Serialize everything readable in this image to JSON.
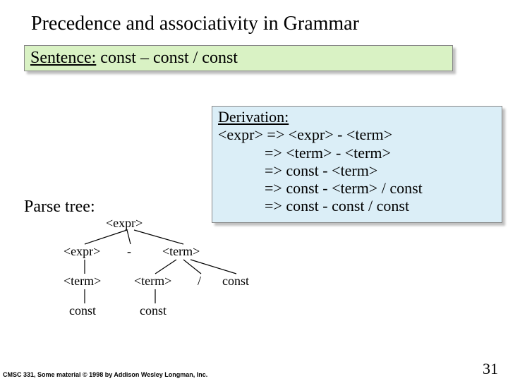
{
  "title": "Precedence and associativity in Grammar",
  "sentence": {
    "label": "Sentence:",
    "text": " const – const / const"
  },
  "derivation": {
    "label": "Derivation:",
    "line1": "<expr> => <expr> - <term>",
    "line2": "=> <term> - <term>",
    "line3": "=> const - <term>",
    "line4": "=> const - <term> / const",
    "line5": "=> const - const / const"
  },
  "parse_label": "Parse tree:",
  "tree": {
    "root": "<expr>",
    "l2a": "<expr>",
    "l2b": "-",
    "l2c": "<term>",
    "l3a": "<term>",
    "l3b": "<term>",
    "l3c": "/",
    "l3d": "const",
    "l4a": "const",
    "l4b": "const"
  },
  "footer": "CMSC 331, Some material © 1998 by Addison Wesley Longman, Inc.",
  "page": "31"
}
